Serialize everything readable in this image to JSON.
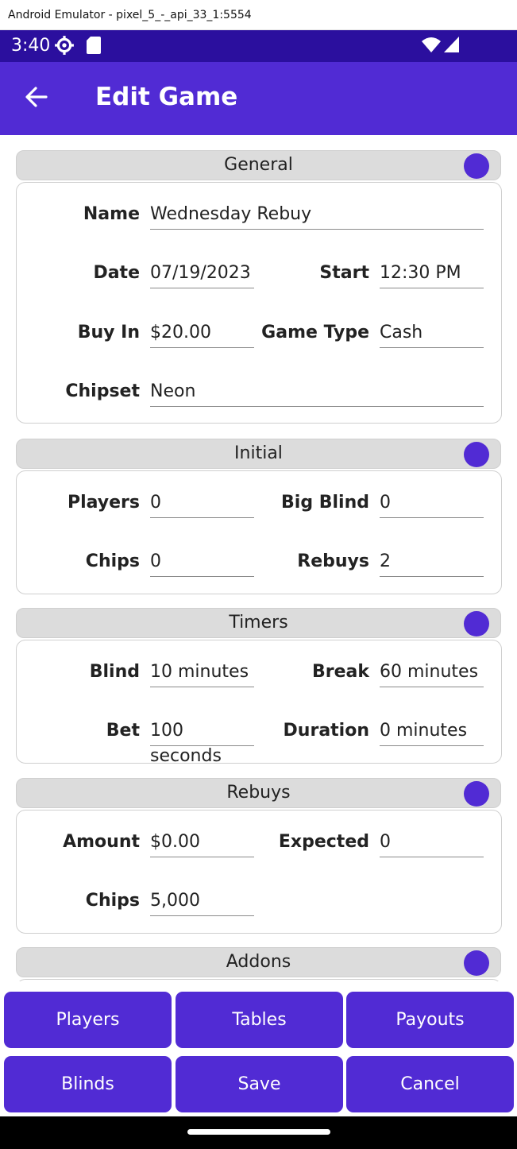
{
  "window": {
    "title": "Android Emulator - pixel_5_-_api_33_1:5554"
  },
  "status_bar": {
    "time": "3:40",
    "icons": [
      "settings-icon",
      "sd-card-icon",
      "wifi-icon",
      "signal-icon"
    ]
  },
  "appbar": {
    "title": "Edit Game",
    "back_icon": "arrow-left-icon"
  },
  "sections": {
    "general": {
      "title": "General",
      "name_label": "Name",
      "name_value": "Wednesday Rebuy",
      "date_label": "Date",
      "date_value": "07/19/2023",
      "start_label": "Start",
      "start_value": "12:30 PM",
      "buyin_label": "Buy In",
      "buyin_value": "$20.00",
      "gametype_label": "Game Type",
      "gametype_value": "Cash",
      "chipset_label": "Chipset",
      "chipset_value": "Neon"
    },
    "initial": {
      "title": "Initial",
      "players_label": "Players",
      "players_value": "0",
      "bigblind_label": "Big Blind",
      "bigblind_value": "0",
      "chips_label": "Chips",
      "chips_value": "0",
      "rebuys_label": "Rebuys",
      "rebuys_value": "2"
    },
    "timers": {
      "title": "Timers",
      "blind_label": "Blind",
      "blind_value": "10 minutes",
      "break_label": "Break",
      "break_value": "60 minutes",
      "bet_label": "Bet",
      "bet_value": "100 seconds",
      "duration_label": "Duration",
      "duration_value": "0 minutes"
    },
    "rebuys": {
      "title": "Rebuys",
      "amount_label": "Amount",
      "amount_value": "$0.00",
      "expected_label": "Expected",
      "expected_value": "0",
      "chips_label": "Chips",
      "chips_value": "5,000"
    },
    "addons": {
      "title": "Addons"
    }
  },
  "buttons": {
    "players": "Players",
    "tables": "Tables",
    "payouts": "Payouts",
    "blinds": "Blinds",
    "save": "Save",
    "cancel": "Cancel"
  },
  "colors": {
    "primary": "#512bd4",
    "status_bar": "#2b0f9e",
    "header_bg": "#dcdcdc"
  }
}
